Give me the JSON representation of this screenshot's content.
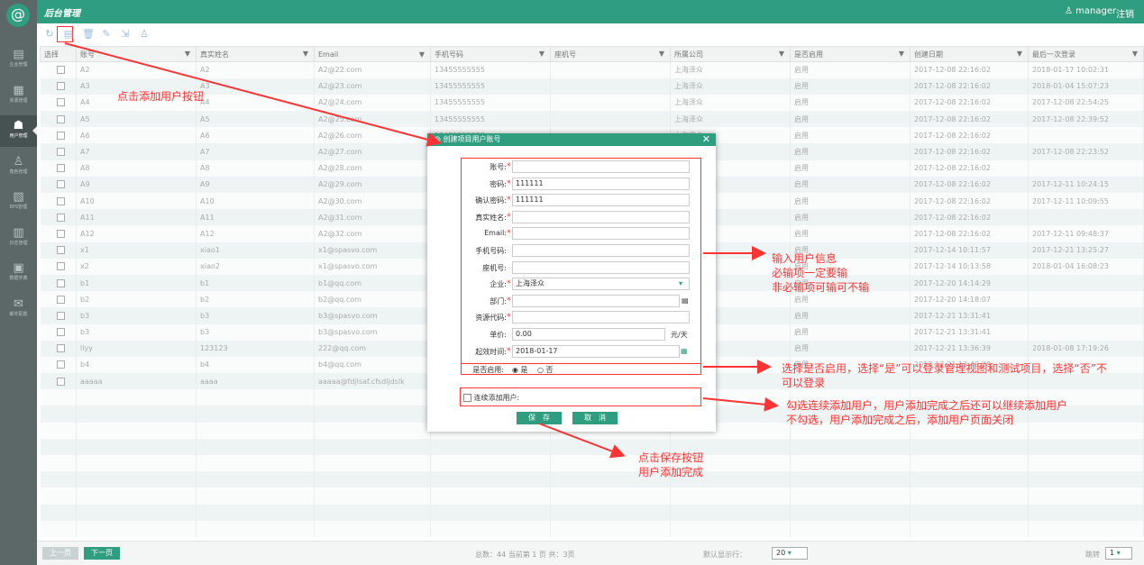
{
  "app": {
    "title": "后台管理",
    "user": "manager",
    "logout": "注销"
  },
  "sidebar": [
    {
      "icon": "building-icon",
      "glyph": "▤",
      "label": "企业管理"
    },
    {
      "icon": "resource-icon",
      "glyph": "▦",
      "label": "资源管理"
    },
    {
      "icon": "users-icon",
      "glyph": "☗",
      "label": "用户管理",
      "active": true
    },
    {
      "icon": "role-icon",
      "glyph": "♙",
      "label": "角色管理"
    },
    {
      "icon": "eps-icon",
      "glyph": "▧",
      "label": "EPS管理"
    },
    {
      "icon": "log-icon",
      "glyph": "▥",
      "label": "日志管理"
    },
    {
      "icon": "dictionary-icon",
      "glyph": "▣",
      "label": "数据字典"
    },
    {
      "icon": "mail-icon",
      "glyph": "✉",
      "label": "邮件配置"
    }
  ],
  "toolbar": [
    {
      "icon": "refresh-icon",
      "glyph": "↻"
    },
    {
      "icon": "add-user-icon",
      "glyph": "▤"
    },
    {
      "icon": "delete-icon",
      "glyph": "🗑"
    },
    {
      "icon": "edit-icon",
      "glyph": "✎"
    },
    {
      "icon": "export-icon",
      "glyph": "⇲"
    },
    {
      "icon": "user-icon",
      "glyph": "♙"
    }
  ],
  "table": {
    "columns": [
      "选择",
      "账号",
      "真实姓名",
      "Email",
      "手机号码",
      "座机号",
      "所属公司",
      "是否启用",
      "创建日期",
      "最后一次登录"
    ],
    "rows": [
      [
        "A2",
        "A2",
        "A2@22.com",
        "13455555555",
        "",
        "上海泽众",
        "启用",
        "2017-12-08 22:16:02",
        "2018-01-17 10:02:31"
      ],
      [
        "A3",
        "A3",
        "A2@23.com",
        "13455555555",
        "",
        "上海泽众",
        "启用",
        "2017-12-08 22:16:02",
        "2018-01-04 15:07:23"
      ],
      [
        "A4",
        "A4",
        "A2@24.com",
        "13455555555",
        "",
        "上海泽众",
        "启用",
        "2017-12-08 22:16:02",
        "2017-12-08 22:54:25"
      ],
      [
        "A5",
        "A5",
        "A2@25.com",
        "13455555555",
        "",
        "上海泽众",
        "启用",
        "2017-12-08 22:16:02",
        "2017-12-08 22:39:52"
      ],
      [
        "A6",
        "A6",
        "A2@26.com",
        "13455555555",
        "",
        "上海泽众",
        "启用",
        "2017-12-08 22:16:02",
        ""
      ],
      [
        "A7",
        "A7",
        "A2@27.com",
        "",
        "",
        "",
        "启用",
        "2017-12-08 22:16:02",
        "2017-12-08 22:23:52"
      ],
      [
        "A8",
        "A8",
        "A2@28.com",
        "",
        "",
        "",
        "启用",
        "2017-12-08 22:16:02",
        ""
      ],
      [
        "A9",
        "A9",
        "A2@29.com",
        "",
        "",
        "",
        "启用",
        "2017-12-08 22:16:02",
        "2017-12-11 10:24:15"
      ],
      [
        "A10",
        "A10",
        "A2@30.com",
        "",
        "",
        "",
        "启用",
        "2017-12-08 22:16:02",
        "2017-12-11 10:09:55"
      ],
      [
        "A11",
        "A11",
        "A2@31.com",
        "",
        "",
        "",
        "启用",
        "2017-12-08 22:16:02",
        ""
      ],
      [
        "A12",
        "A12",
        "A2@32.com",
        "",
        "",
        "",
        "启用",
        "2017-12-08 22:16:02",
        "2017-12-11 09:48:37"
      ],
      [
        "x1",
        "xiao1",
        "x1@spasvo.com",
        "",
        "",
        "",
        "启用",
        "2017-12-14 10:11:57",
        "2017-12-21 13:25:27"
      ],
      [
        "x2",
        "xiao2",
        "x1@spasvo.com",
        "",
        "",
        "",
        "启用",
        "2017-12-14 10:13:58",
        "2018-01-04 16:08:23"
      ],
      [
        "b1",
        "b1",
        "b1@qq.com",
        "",
        "",
        "",
        "启用",
        "2017-12-20 14:14:29",
        ""
      ],
      [
        "b2",
        "b2",
        "b2@qq.com",
        "",
        "",
        "",
        "启用",
        "2017-12-20 14:18:07",
        ""
      ],
      [
        "b3",
        "b3",
        "b3@spasvo.com",
        "",
        "",
        "",
        "启用",
        "2017-12-21 13:31:41",
        ""
      ],
      [
        "b3",
        "b3",
        "b3@spasvo.com",
        "",
        "",
        "",
        "启用",
        "2017-12-21 13:31:41",
        ""
      ],
      [
        "llyy",
        "123123",
        "222@qq.com",
        "",
        "",
        "",
        "启用",
        "2017-12-21 13:36:39",
        "2018-01-08 17:19:26"
      ],
      [
        "b4",
        "b4",
        "b4@qq.com",
        "",
        "",
        "",
        "启用",
        "2017-12-21 13:49:28",
        ""
      ],
      [
        "aaaaa",
        "aaaa",
        "aaaaa@fdjlsaf.cfsdljdslk",
        "",
        "",
        "",
        "",
        "",
        ""
      ],
      [
        "",
        "",
        "",
        "",
        "",
        "",
        "",
        "",
        ""
      ],
      [
        "",
        "",
        "",
        "",
        "",
        "",
        "",
        "",
        ""
      ],
      [
        "",
        "",
        "",
        "",
        "",
        "",
        "",
        "",
        ""
      ],
      [
        "",
        "",
        "",
        "",
        "",
        "",
        "",
        "",
        ""
      ],
      [
        "",
        "",
        "",
        "",
        "",
        "",
        "",
        "",
        ""
      ],
      [
        "",
        "",
        "",
        "",
        "",
        "",
        "",
        "",
        ""
      ],
      [
        "",
        "",
        "",
        "",
        "",
        "",
        "",
        "",
        ""
      ],
      [
        "",
        "",
        "",
        "",
        "",
        "",
        "",
        "",
        ""
      ],
      [
        "",
        "",
        "",
        "",
        "",
        "",
        "",
        "",
        ""
      ]
    ]
  },
  "pager": {
    "prev": "上一页",
    "next": "下一页",
    "summary": "总数：44  当前第 1 页    共：3页",
    "page_size_label": "默认显示行：",
    "page_size": "20",
    "jump_label": "跳转",
    "jump_page": "1"
  },
  "dialog": {
    "title": "创建项目用户账号",
    "close": "✕",
    "fields": [
      {
        "name": "account",
        "label": "账号:",
        "required": true,
        "value": ""
      },
      {
        "name": "password",
        "label": "密码:",
        "required": true,
        "value": "111111"
      },
      {
        "name": "confirm-password",
        "label": "确认密码:",
        "required": true,
        "value": "111111"
      },
      {
        "name": "real-name",
        "label": "真实姓名:",
        "required": true,
        "value": ""
      },
      {
        "name": "email",
        "label": "Email:",
        "required": true,
        "value": ""
      },
      {
        "name": "mobile",
        "label": "手机号码:",
        "required": false,
        "value": ""
      },
      {
        "name": "landline",
        "label": "座机号:",
        "required": false,
        "value": ""
      },
      {
        "name": "company",
        "label": "企业:",
        "required": true,
        "value": "上海泽众"
      },
      {
        "name": "department",
        "label": "部门:",
        "required": true,
        "value": ""
      },
      {
        "name": "resource-code",
        "label": "资源代码:",
        "required": true,
        "value": ""
      },
      {
        "name": "unit-price",
        "label": "单价:",
        "required": false,
        "value": "0.00",
        "suffix": "元/天"
      },
      {
        "name": "start-time",
        "label": "起效时间:",
        "required": true,
        "value": "2018-01-17"
      }
    ],
    "enabled_label": "是否启用:",
    "enabled_yes": "是",
    "enabled_no": "否",
    "continuous_label": "连续添加用户:",
    "save": "保　存",
    "cancel": "取　消"
  },
  "annotations": {
    "add_button": "点击添加用户按钮",
    "input_info": [
      "输入用户信息",
      "必输项一定要输",
      "非必输项可输可不输"
    ],
    "enabled": [
      "选择是否启用，选择“是”可以登录管理视图和测试项目，选择“否”不",
      "可以登录"
    ],
    "continuous": [
      "勾选连续添加用户，用户添加完成之后还可以继续添加用户",
      "不勾选，用户添加完成之后，添加用户页面关闭"
    ],
    "save": [
      "点击保存按钮",
      "用户添加完成"
    ]
  }
}
